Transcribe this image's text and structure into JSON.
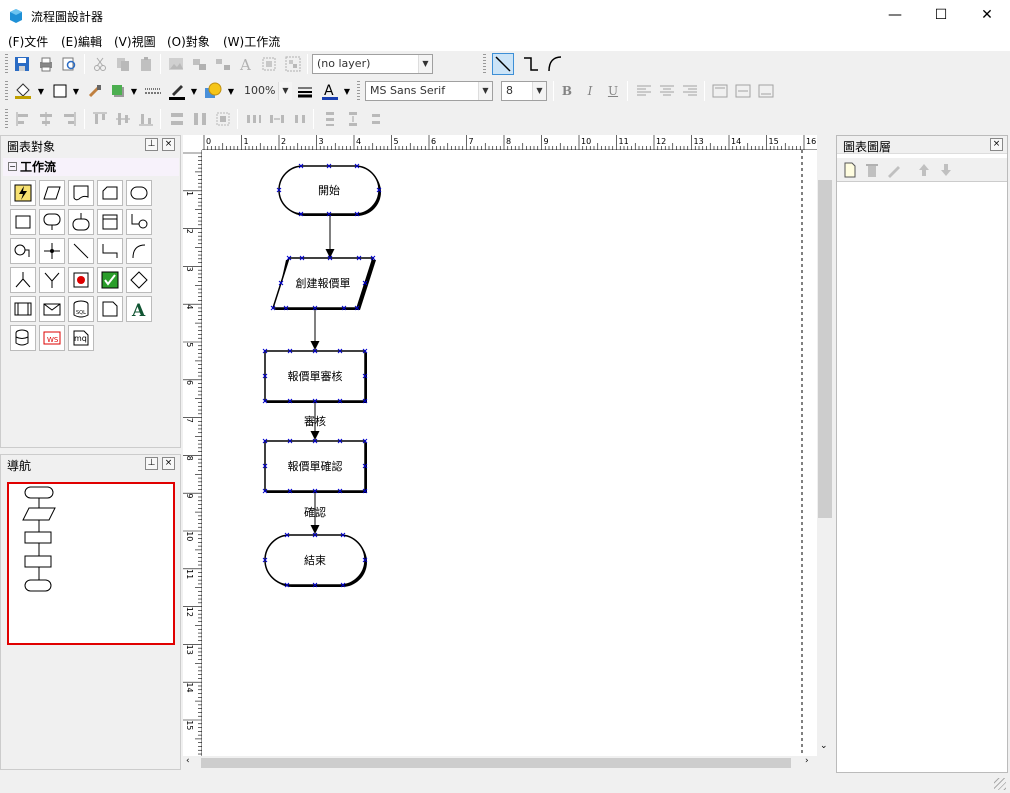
{
  "window": {
    "title": "流程圖設計器",
    "minimize": "—",
    "maximize": "☐",
    "close": "✕"
  },
  "menu": [
    "(F)文件",
    "(E)編輯",
    "(V)視圖",
    "(O)對象",
    "(W)工作流"
  ],
  "toolbar": {
    "layer_combo": "(no layer)",
    "zoom": "100%",
    "font": "MS Sans Serif",
    "font_size": "8"
  },
  "panels": {
    "objects": "圖表對象",
    "workflow_group": "工作流",
    "navigator": "導航",
    "layers": "圖表圖層"
  },
  "diagram": {
    "nodes": [
      {
        "id": "start",
        "label": "開始",
        "shape": "terminal"
      },
      {
        "id": "create",
        "label": "創建報價單",
        "shape": "parallelogram"
      },
      {
        "id": "review",
        "label": "報價單審核",
        "shape": "process"
      },
      {
        "id": "confirm",
        "label": "報價單確認",
        "shape": "process"
      },
      {
        "id": "end",
        "label": "結束",
        "shape": "terminal"
      }
    ],
    "edges": [
      {
        "from": "start",
        "to": "create",
        "label": ""
      },
      {
        "from": "create",
        "to": "review",
        "label": ""
      },
      {
        "from": "review",
        "to": "confirm",
        "label": "審核"
      },
      {
        "from": "confirm",
        "to": "end",
        "label": "確認"
      }
    ]
  },
  "ruler": {
    "h": [
      "0",
      "1",
      "2",
      "3",
      "4",
      "5",
      "6",
      "7",
      "8",
      "9",
      "10",
      "11",
      "12",
      "13",
      "14",
      "15",
      "16"
    ],
    "v": [
      "1",
      "2",
      "3",
      "4",
      "5",
      "6",
      "7",
      "8",
      "9",
      "10",
      "11",
      "12",
      "13",
      "14",
      "15"
    ]
  },
  "colors": {
    "accent": "#0078d7",
    "nav_border": "#e00000",
    "handle": "#0000cc"
  }
}
